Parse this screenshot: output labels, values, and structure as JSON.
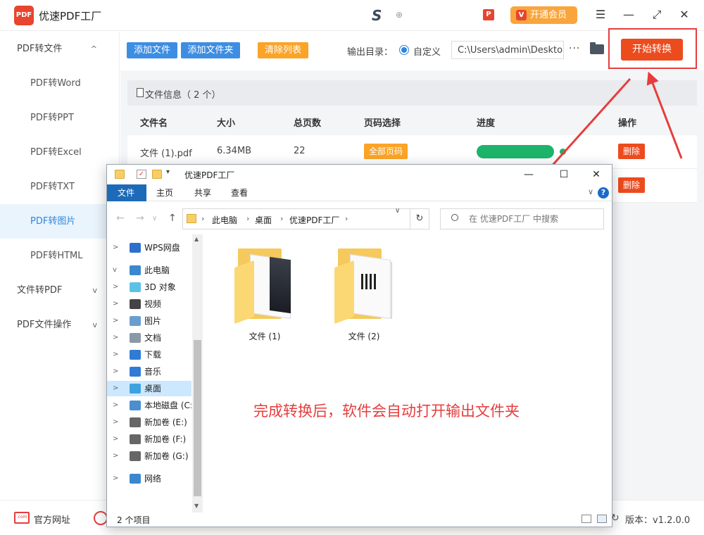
{
  "app": {
    "title": "优速PDF工厂",
    "logo_text": "PDF",
    "vip_label": "开通会员",
    "vip_icon_text": "V",
    "tb_p_text": "P",
    "tb_s_text": "S",
    "tb_dot_text": "⊕"
  },
  "window_controls": {
    "menu": "☰",
    "minimize": "—",
    "maximize": "⤢",
    "close": "✕"
  },
  "sidebar": {
    "items": [
      {
        "label": "PDF转文件",
        "chevron": "^"
      },
      {
        "label": "PDF转Word"
      },
      {
        "label": "PDF转PPT"
      },
      {
        "label": "PDF转Excel"
      },
      {
        "label": "PDF转TXT"
      },
      {
        "label": "PDF转图片"
      },
      {
        "label": "PDF转HTML"
      },
      {
        "label": "文件转PDF",
        "chevron": "v"
      },
      {
        "label": "PDF文件操作",
        "chevron": "v"
      }
    ]
  },
  "toolbar": {
    "add_file": "添加文件",
    "add_folder": "添加文件夹",
    "clear_list": "清除列表",
    "output_label": "输出目录：",
    "radio_label": "自定义",
    "path_value": "C:\\Users\\admin\\Desktop",
    "more": "···",
    "start": "开始转换"
  },
  "file_list": {
    "info": "文件信息（ 2 个）",
    "headers": [
      "文件名",
      "大小",
      "总页数",
      "页码选择",
      "进度",
      "操作"
    ],
    "rows": [
      {
        "name": "文件 (1).pdf",
        "size": "6.34MB",
        "pages": "22",
        "page_select": "全部页码",
        "progress": 100,
        "action": "删除"
      },
      {
        "action": "删除"
      }
    ]
  },
  "footer": {
    "site_label": "官方网址",
    "site_icon_text": ".com",
    "version": "版本：v1.2.0.0",
    "version_icon": "↻"
  },
  "explorer": {
    "title": "优速PDF工厂",
    "qa_check": "✓",
    "qa_down": "▾",
    "close": "✕",
    "minimize": "—",
    "maximize": "☐",
    "tabs": [
      "文件",
      "主页",
      "共享",
      "查看"
    ],
    "help": "?",
    "collapse": "∨",
    "nav": {
      "back": "←",
      "forward": "→",
      "up": "↑"
    },
    "breadcrumbs": [
      "此电脑",
      "桌面",
      "优速PDF工厂"
    ],
    "crumb_sep": "›",
    "addr_drop": "∨",
    "refresh": "↻",
    "search_placeholder": "在 优速PDF工厂 中搜索",
    "tree": [
      {
        "label": "WPS网盘",
        "icon": "cloud-icon",
        "chevron": ">",
        "color": "#2d6fcc"
      },
      {
        "label": "此电脑",
        "icon": "computer-icon",
        "chevron": "v",
        "color": "#3a87d0"
      },
      {
        "label": "3D 对象",
        "icon": "cube-icon",
        "chevron": ">",
        "color": "#5bc2e7"
      },
      {
        "label": "视频",
        "icon": "film-icon",
        "chevron": ">",
        "color": "#444"
      },
      {
        "label": "图片",
        "icon": "picture-icon",
        "chevron": ">",
        "color": "#6a9ed1"
      },
      {
        "label": "文档",
        "icon": "document-icon",
        "chevron": ">",
        "color": "#8a98a8"
      },
      {
        "label": "下载",
        "icon": "download-icon",
        "chevron": ">",
        "color": "#2f7bd6"
      },
      {
        "label": "音乐",
        "icon": "music-icon",
        "chevron": ">",
        "color": "#2f7bd6"
      },
      {
        "label": "桌面",
        "icon": "desktop-icon",
        "chevron": ">",
        "color": "#3ea1e0",
        "selected": true
      },
      {
        "label": "本地磁盘 (C:)",
        "icon": "disk-icon",
        "chevron": ">",
        "color": "#4a8fd0"
      },
      {
        "label": "新加卷 (E:)",
        "icon": "drive-icon",
        "chevron": ">",
        "color": "#666"
      },
      {
        "label": "新加卷 (F:)",
        "icon": "drive-icon",
        "chevron": ">",
        "color": "#666"
      },
      {
        "label": "新加卷 (G:)",
        "icon": "drive-icon",
        "chevron": ">",
        "color": "#666"
      },
      {
        "label": "网络",
        "icon": "network-icon",
        "chevron": ">",
        "color": "#3a87d0"
      }
    ],
    "folders": [
      {
        "label": "文件 (1)"
      },
      {
        "label": "文件 (2)"
      }
    ],
    "status": "2 个项目"
  },
  "annotation": "完成转换后，软件会自动打开输出文件夹",
  "colors": {
    "accent_blue": "#3d8ee3",
    "accent_orange": "#fba427",
    "accent_red": "#ec4b1e",
    "annotation_red": "#e73d3d",
    "progress_green": "#1db46a"
  }
}
